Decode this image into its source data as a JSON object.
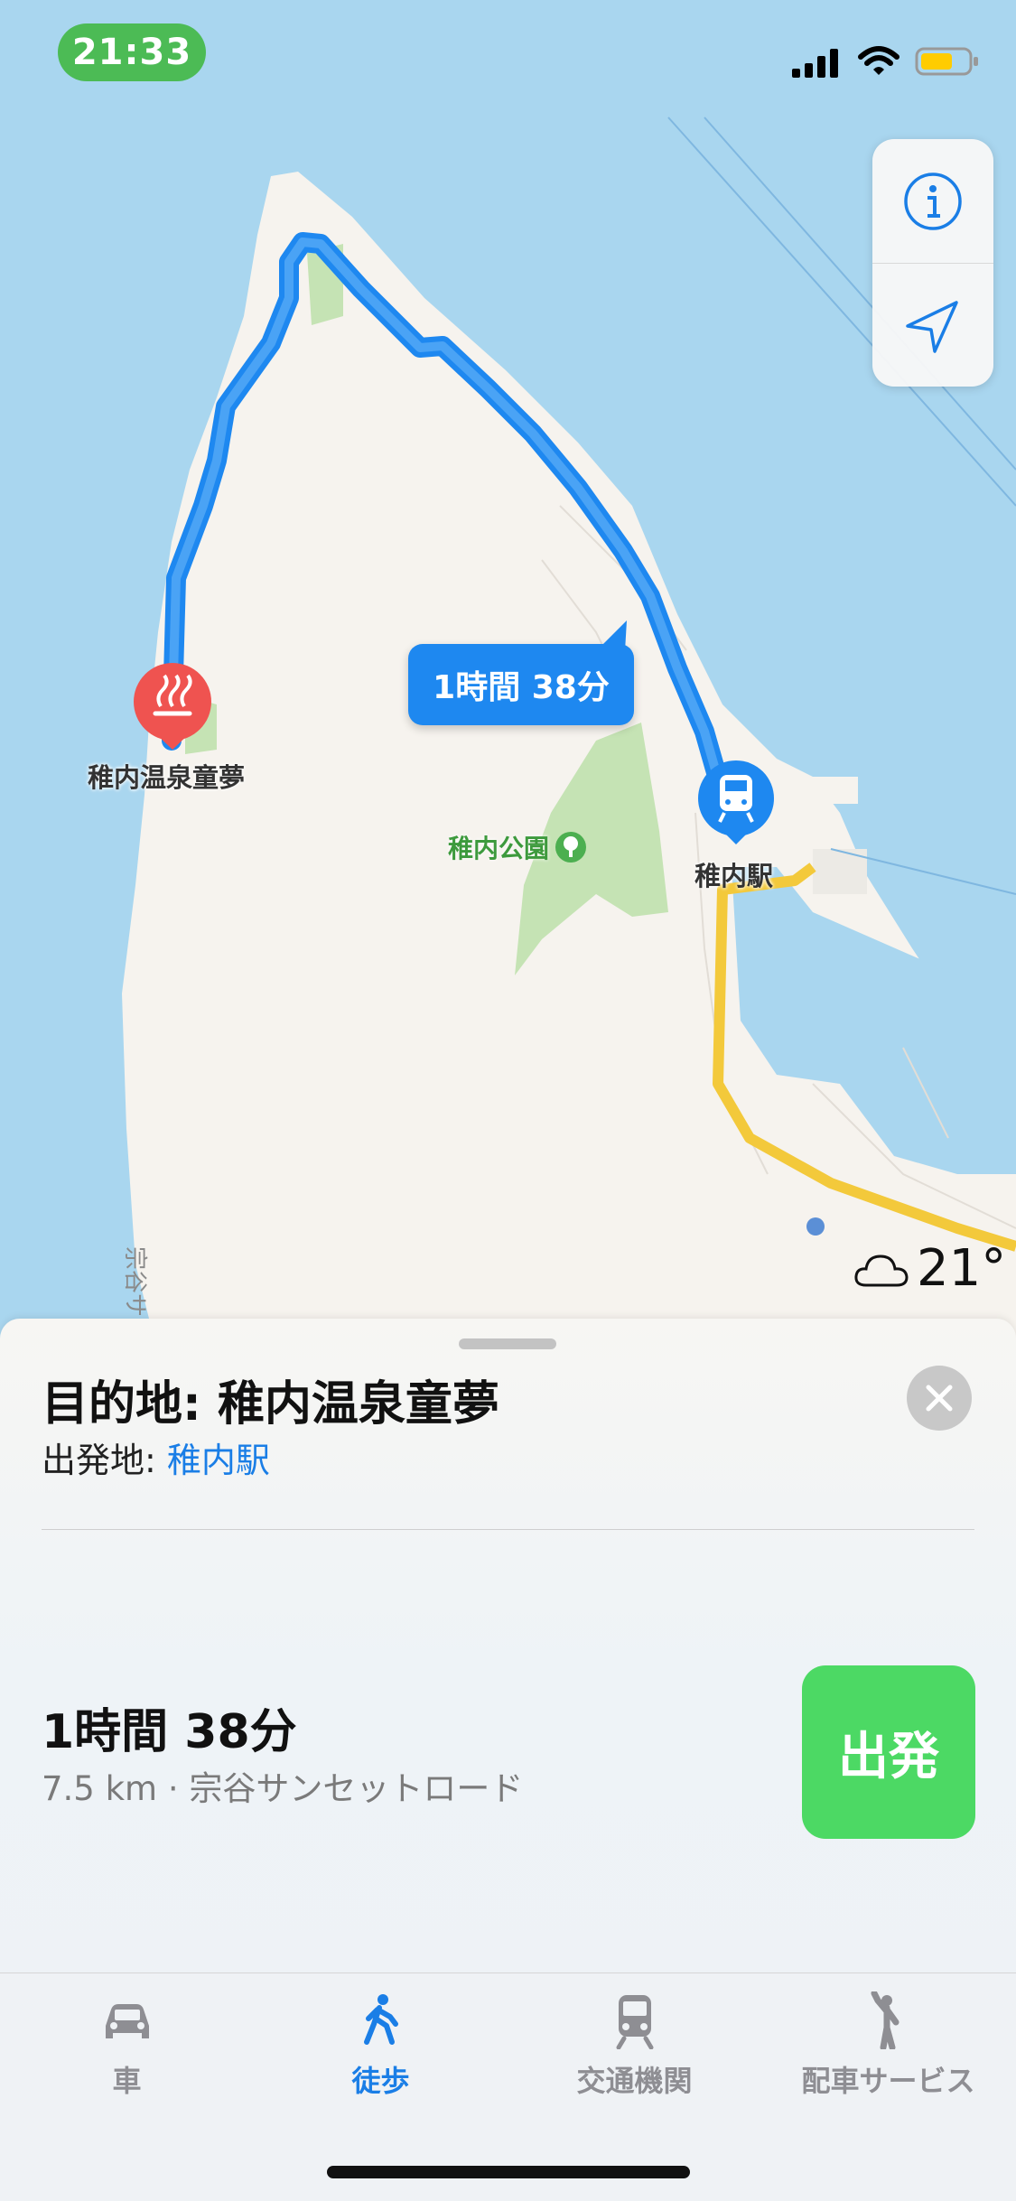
{
  "status_bar": {
    "time": "21:33"
  },
  "map": {
    "route_bubble": "1時間 38分",
    "destination_marker": "稚内温泉童夢",
    "park_label": "稚内公園",
    "station_marker": "稚内駅",
    "road_label": "宗谷サン",
    "weather": {
      "icon": "cloud-icon",
      "temperature": "21°"
    },
    "colors": {
      "water": "#a9d6ef",
      "land": "#f6f3ee",
      "route": "#1e88f0",
      "park": "#c5e3b4",
      "highway": "#f3c93b"
    }
  },
  "sheet": {
    "destination_title": "目的地: 稚内温泉童夢",
    "origin_label": "出発地: ",
    "origin_value": "稚内駅",
    "eta": "1時間 38分",
    "detail": "7.5 km · 宗谷サンセットロード",
    "go_button": "出発"
  },
  "tabs": [
    {
      "label": "車",
      "icon": "car-icon",
      "active": false
    },
    {
      "label": "徒歩",
      "icon": "walk-icon",
      "active": true
    },
    {
      "label": "交通機関",
      "icon": "train-icon",
      "active": false
    },
    {
      "label": "配車サービス",
      "icon": "rideshare-icon",
      "active": false
    }
  ],
  "accent_color": "#1a7ee6",
  "go_color": "#4cd964"
}
